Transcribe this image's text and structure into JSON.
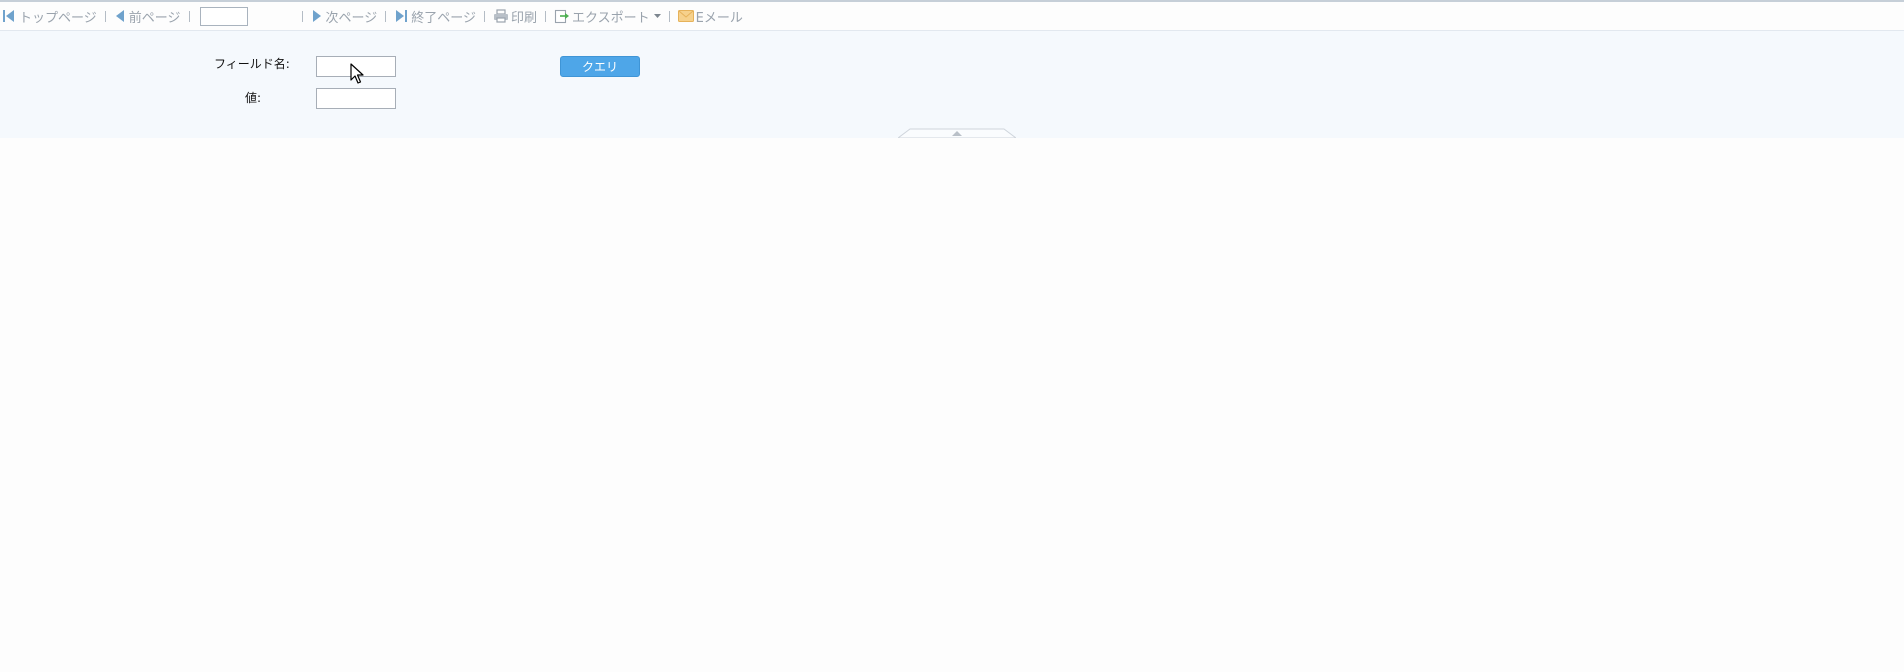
{
  "toolbar": {
    "first_page": {
      "label": "トップページ",
      "icon": "first-page-icon"
    },
    "prev_page": {
      "label": "前ページ",
      "icon": "prev-page-icon"
    },
    "page_number": {
      "value": "",
      "placeholder": ""
    },
    "next_page": {
      "label": "次ページ",
      "icon": "next-page-icon"
    },
    "last_page": {
      "label": "終了ページ",
      "icon": "last-page-icon"
    },
    "print": {
      "label": "印刷",
      "icon": "printer-icon"
    },
    "export": {
      "label": "エクスポート",
      "icon": "export-icon",
      "dropdown_icon": "caret-down-icon"
    },
    "email": {
      "label": "Eメール",
      "icon": "mail-icon"
    }
  },
  "params": {
    "field_name": {
      "label": "フィールド名:",
      "value": ""
    },
    "value": {
      "label": "値:",
      "value": ""
    },
    "query_button": "クエリ"
  },
  "colors": {
    "accent": "#4ea6e8",
    "icon_blue": "#6fa2cc",
    "toolbar_text": "#9aa3ad",
    "panel_bg": "#f5f9fd"
  }
}
